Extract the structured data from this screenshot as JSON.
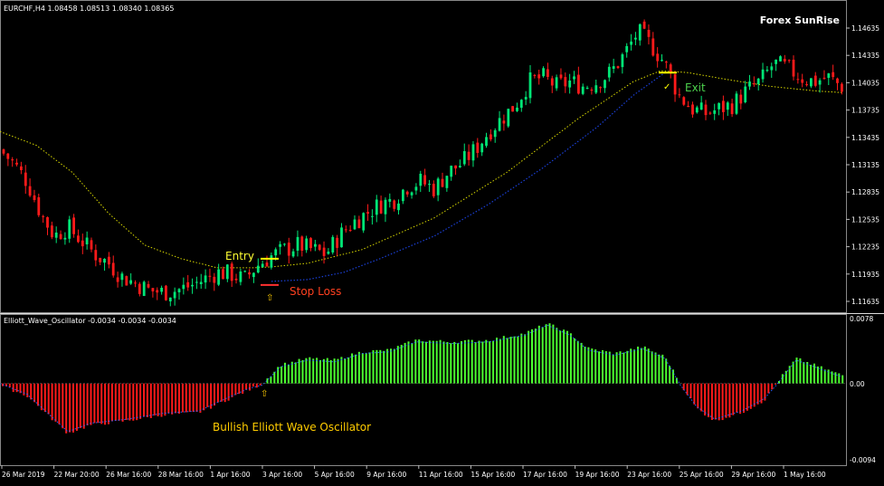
{
  "window": {
    "symbol_header": "EURCHF,H4  1.08458 1.08513 1.08340 1.08365",
    "brand": "Forex SunRise",
    "indicator_header": "Elliott_Wave_Oscillator -0.0034 -0.0034 -0.0034"
  },
  "annotations": {
    "entry": "Entry",
    "stop_loss": "Stop Loss",
    "exit": "Exit",
    "oscillator_label": "Bullish Elliott Wave Oscillator",
    "arrow_glyph": "⇧",
    "exit_glyph": "✓"
  },
  "colors": {
    "background": "#000000",
    "bull_candle": "#00e676",
    "bear_candle": "#ff1a1a",
    "ma_line": "#d8d800",
    "trend_line": "#1a3fd6",
    "osc_bull": "#4cff30",
    "osc_bear": "#ff1a1a",
    "osc_signal": "#2a5fff",
    "entry_line": "#ffff00",
    "stop_line": "#ff3030",
    "entry_text": "#ffff33",
    "stop_text": "#ff4020",
    "exit_text": "#4cd04c",
    "label_text": "#ffcc00",
    "axis_text": "#ffffff"
  },
  "chart_data": [
    {
      "type": "candlestick",
      "title": "",
      "price_ticks": [
        "1.14635",
        "1.14335",
        "1.14035",
        "1.13735",
        "1.13435",
        "1.13135",
        "1.12835",
        "1.12535",
        "1.12235",
        "1.11935",
        "1.11635"
      ],
      "ylim": [
        1.1151,
        1.1482
      ],
      "time_labels": [
        "26 Mar 2019",
        "22 Mar 20:00",
        "26 Mar 16:00",
        "28 Mar 16:00",
        "1 Apr 16:00",
        "3 Apr 16:00",
        "5 Apr 16:00",
        "9 Apr 16:00",
        "11 Apr 16:00",
        "15 Apr 16:00",
        "17 Apr 16:00",
        "19 Apr 16:00",
        "23 Apr 16:00",
        "25 Apr 16:00",
        "29 Apr 16:00",
        "1 May 16:00"
      ],
      "close_path": [
        [
          0,
          1.1325
        ],
        [
          15,
          1.131
        ],
        [
          30,
          1.129
        ],
        [
          45,
          1.1255
        ],
        [
          60,
          1.123
        ],
        [
          75,
          1.124
        ],
        [
          90,
          1.1225
        ],
        [
          105,
          1.121
        ],
        [
          120,
          1.12
        ],
        [
          135,
          1.1185
        ],
        [
          150,
          1.1178
        ],
        [
          165,
          1.117
        ],
        [
          180,
          1.1168
        ],
        [
          195,
          1.117
        ],
        [
          210,
          1.1175
        ],
        [
          225,
          1.1182
        ],
        [
          240,
          1.119
        ],
        [
          255,
          1.1188
        ],
        [
          270,
          1.1182
        ],
        [
          285,
          1.1198
        ],
        [
          300,
          1.1208
        ],
        [
          315,
          1.1215
        ],
        [
          330,
          1.122
        ],
        [
          345,
          1.1215
        ],
        [
          360,
          1.121
        ],
        [
          375,
          1.123
        ],
        [
          390,
          1.1245
        ],
        [
          405,
          1.1255
        ],
        [
          420,
          1.1265
        ],
        [
          435,
          1.127
        ],
        [
          450,
          1.1285
        ],
        [
          465,
          1.129
        ],
        [
          480,
          1.1282
        ],
        [
          495,
          1.13
        ],
        [
          510,
          1.131
        ],
        [
          525,
          1.1325
        ],
        [
          540,
          1.1345
        ],
        [
          555,
          1.136
        ],
        [
          570,
          1.1375
        ],
        [
          585,
          1.14
        ],
        [
          600,
          1.1405
        ],
        [
          615,
          1.1395
        ],
        [
          630,
          1.14
        ],
        [
          645,
          1.1395
        ],
        [
          660,
          1.14
        ],
        [
          675,
          1.141
        ],
        [
          690,
          1.143
        ],
        [
          705,
          1.1455
        ],
        [
          720,
          1.144
        ],
        [
          735,
          1.142
        ],
        [
          750,
          1.1385
        ],
        [
          765,
          1.137
        ],
        [
          780,
          1.1365
        ],
        [
          795,
          1.137
        ],
        [
          810,
          1.1375
        ],
        [
          825,
          1.139
        ],
        [
          840,
          1.14
        ],
        [
          855,
          1.142
        ],
        [
          870,
          1.1415
        ],
        [
          885,
          1.1405
        ],
        [
          900,
          1.14
        ],
        [
          915,
          1.1405
        ],
        [
          930,
          1.1395
        ]
      ],
      "moving_average": [
        [
          0,
          1.1345
        ],
        [
          40,
          1.133
        ],
        [
          80,
          1.13
        ],
        [
          120,
          1.1255
        ],
        [
          160,
          1.122
        ],
        [
          200,
          1.1205
        ],
        [
          240,
          1.1195
        ],
        [
          280,
          1.1195
        ],
        [
          300,
          1.1196
        ],
        [
          340,
          1.12
        ],
        [
          400,
          1.1215
        ],
        [
          480,
          1.125
        ],
        [
          560,
          1.13
        ],
        [
          640,
          1.136
        ],
        [
          700,
          1.14
        ],
        [
          730,
          1.1412
        ],
        [
          760,
          1.141
        ],
        [
          800,
          1.1403
        ],
        [
          850,
          1.1395
        ],
        [
          900,
          1.139
        ],
        [
          930,
          1.1388
        ]
      ],
      "trend_line": [
        [
          300,
          1.118
        ],
        [
          340,
          1.1182
        ],
        [
          380,
          1.119
        ],
        [
          420,
          1.1205
        ],
        [
          480,
          1.123
        ],
        [
          540,
          1.1265
        ],
        [
          600,
          1.1305
        ],
        [
          660,
          1.135
        ],
        [
          700,
          1.1385
        ],
        [
          735,
          1.141
        ]
      ],
      "entry_level": 1.1205,
      "stop_level": 1.1176,
      "exit_level": 1.141
    },
    {
      "type": "bar",
      "title": "Elliott_Wave_Oscillator",
      "y_ticks": [
        "0.0078",
        "0.00",
        "-0.0094"
      ],
      "ylim": [
        -0.0094,
        0.0078
      ],
      "osc_path": [
        [
          0,
          -0.0002
        ],
        [
          30,
          -0.0015
        ],
        [
          60,
          -0.0045
        ],
        [
          75,
          -0.006
        ],
        [
          100,
          -0.005
        ],
        [
          140,
          -0.0045
        ],
        [
          180,
          -0.0038
        ],
        [
          220,
          -0.0035
        ],
        [
          250,
          -0.002
        ],
        [
          275,
          -0.0008
        ],
        [
          290,
          0.0
        ],
        [
          310,
          0.0022
        ],
        [
          340,
          0.003
        ],
        [
          370,
          0.0028
        ],
        [
          400,
          0.0038
        ],
        [
          430,
          0.004
        ],
        [
          460,
          0.0052
        ],
        [
          500,
          0.005
        ],
        [
          540,
          0.0052
        ],
        [
          580,
          0.006
        ],
        [
          605,
          0.0072
        ],
        [
          630,
          0.006
        ],
        [
          650,
          0.0042
        ],
        [
          680,
          0.0036
        ],
        [
          710,
          0.0044
        ],
        [
          735,
          0.0032
        ],
        [
          752,
          0.0
        ],
        [
          770,
          -0.003
        ],
        [
          790,
          -0.0045
        ],
        [
          820,
          -0.0035
        ],
        [
          845,
          -0.002
        ],
        [
          858,
          0.0
        ],
        [
          880,
          0.003
        ],
        [
          910,
          0.0018
        ],
        [
          930,
          0.001
        ]
      ]
    }
  ]
}
